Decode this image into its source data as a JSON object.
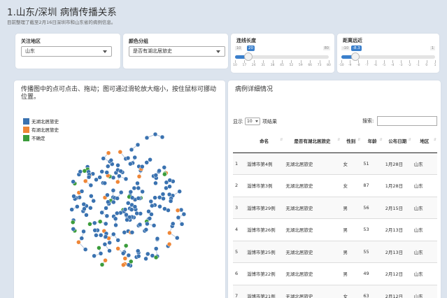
{
  "header": {
    "title": "1.山东/深圳 病情传播关系",
    "subtitle": "目前整理了截至2月16日深圳市和山东省的病例信息。"
  },
  "controls": {
    "region": {
      "label": "关注地区",
      "value": "山东"
    },
    "color_group": {
      "label": "颜色分组",
      "value": "是否有湖北居旅史"
    },
    "link_length": {
      "label": "连线长度",
      "min": "10",
      "max": "80",
      "value": "20",
      "value_fraction": 0.14,
      "ticks": [
        "10",
        "17",
        "24",
        "31",
        "38",
        "45",
        "52",
        "59",
        "66",
        "73",
        "80"
      ]
    },
    "distance": {
      "label": "距离远近",
      "min": "-10",
      "max": "1",
      "value": "-8.3",
      "value_fraction": 0.15,
      "ticks": [
        "-10",
        "-9",
        "-8",
        "-7",
        "-6",
        "-5",
        "-4",
        "-3",
        "-2",
        "-1",
        "0",
        "1"
      ]
    }
  },
  "network_panel": {
    "title": "传播图中的点可点击、拖动；图可通过滑轮放大缩小，按住鼠标可挪动位置。",
    "legend": [
      {
        "label": "无湖北居旅史",
        "color": "#3a72b0"
      },
      {
        "label": "有湖北居旅史",
        "color": "#ef8636"
      },
      {
        "label": "不确定",
        "color": "#3b9c3b"
      }
    ]
  },
  "table_panel": {
    "title": "病例详细情况",
    "show_prefix": "显示",
    "page_length": "10",
    "show_suffix": "项结果",
    "search_label": "搜索:",
    "columns": [
      "",
      "命名",
      "是否有湖北居旅史",
      "性别",
      "年龄",
      "公布日期",
      "地区"
    ],
    "rows": [
      [
        "1",
        "淄博市第4例",
        "无湖北居旅史",
        "女",
        "51",
        "1月28日",
        "山东"
      ],
      [
        "2",
        "淄博市第3例",
        "无湖北居旅史",
        "女",
        "87",
        "1月28日",
        "山东"
      ],
      [
        "3",
        "淄博市第29例",
        "无湖北居旅史",
        "男",
        "56",
        "2月15日",
        "山东"
      ],
      [
        "4",
        "淄博市第26例",
        "无湖北居旅史",
        "男",
        "53",
        "2月13日",
        "山东"
      ],
      [
        "5",
        "淄博市第25例",
        "无湖北居旅史",
        "男",
        "55",
        "2月13日",
        "山东"
      ],
      [
        "6",
        "淄博市第22例",
        "无湖北居旅史",
        "男",
        "49",
        "2月12日",
        "山东"
      ],
      [
        "7",
        "淄博市第21例",
        "无湖北居旅史",
        "女",
        "63",
        "2月12日",
        "山东"
      ]
    ]
  }
}
